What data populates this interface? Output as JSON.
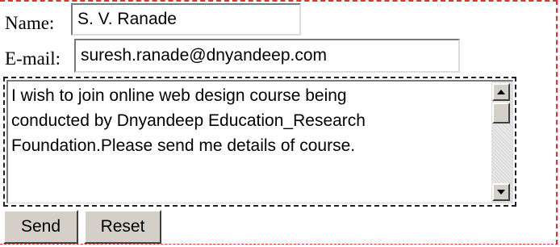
{
  "form": {
    "name_label": "Name:",
    "name_value": "S. V. Ranade",
    "email_label": "E-mail:",
    "email_value": "suresh.ranade@dnyandeep.com",
    "message_value": "I wish to join online web design course being\nconducted by Dnyandeep Education_Research\nFoundation.Please send me details of course.",
    "send_label": "Send",
    "reset_label": "Reset"
  },
  "colors": {
    "frame_border": "#e03030",
    "button_face": "#d4d0c8"
  },
  "icons": {
    "scroll_up": "triangle-up",
    "scroll_down": "triangle-down"
  }
}
